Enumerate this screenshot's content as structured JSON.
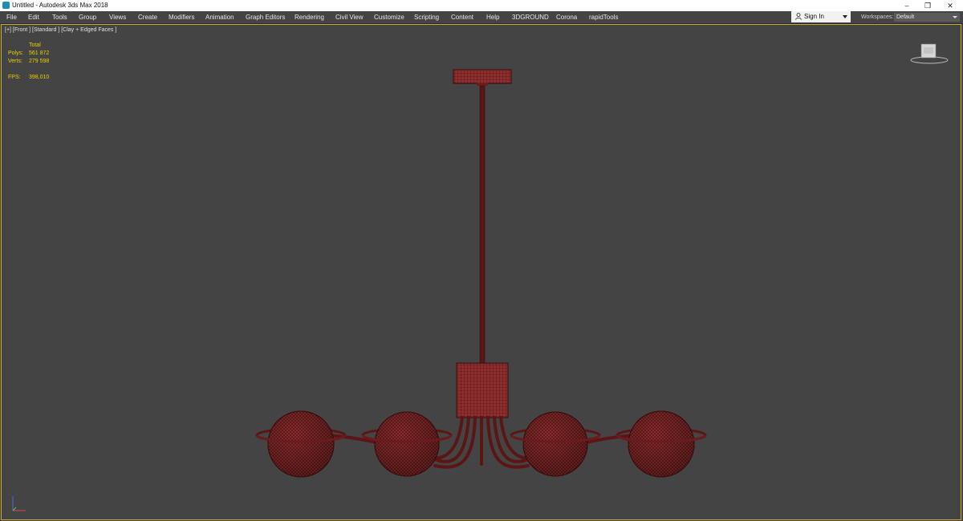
{
  "window": {
    "title": "Untitled - Autodesk 3ds Max 2018",
    "controls": {
      "minimize": "–",
      "restore": "❐",
      "close": "✕"
    }
  },
  "menu": [
    "File",
    "Edit",
    "Tools",
    "Group",
    "Views",
    "Create",
    "Modifiers",
    "Animation",
    "Graph Editors",
    "Rendering",
    "Civil View",
    "Customize",
    "Scripting",
    "Content",
    "Help",
    "3DGROUND",
    "Corona",
    "rapidTools"
  ],
  "account": {
    "sign_in_label": "Sign In"
  },
  "workspaces": {
    "label": "Workspaces:",
    "value": "Default"
  },
  "viewport": {
    "label": "[+] [Front ] [Standard ] [Clay + Edged Faces ]",
    "stats": {
      "header": "Total",
      "polys_label": "Polys:",
      "polys_value": "561 872",
      "verts_label": "Verts:",
      "verts_value": "279 598",
      "fps_label": "FPS:",
      "fps_value": "398,010"
    },
    "viewcube_icon": "viewcube-icon",
    "axis_icon": "axis-tripod-icon"
  },
  "colors": {
    "menu_bg": "#444444",
    "viewport_bg": "#444444",
    "viewport_border": "#c9a92e",
    "stats_text": "#e8d000",
    "model_fill": "#8b2c2c",
    "model_wire": "#3a0c0c"
  },
  "icons": {
    "app": "3dsmax-app-icon",
    "user": "user-icon"
  }
}
